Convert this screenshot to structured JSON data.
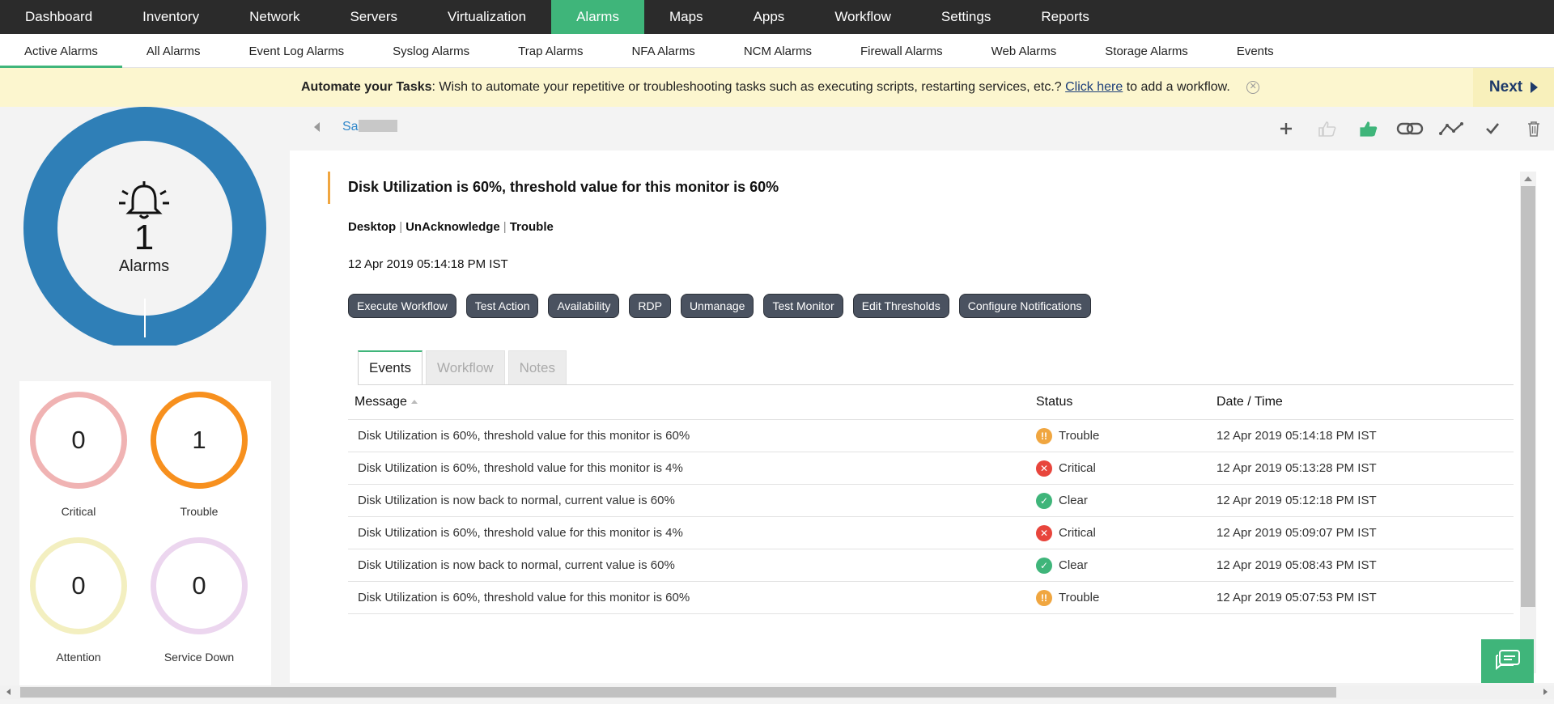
{
  "topnav": {
    "items": [
      "Dashboard",
      "Inventory",
      "Network",
      "Servers",
      "Virtualization",
      "Alarms",
      "Maps",
      "Apps",
      "Workflow",
      "Settings",
      "Reports"
    ],
    "active": "Alarms"
  },
  "subnav": {
    "items": [
      "Active Alarms",
      "All Alarms",
      "Event Log Alarms",
      "Syslog Alarms",
      "Trap Alarms",
      "NFA Alarms",
      "NCM Alarms",
      "Firewall Alarms",
      "Web Alarms",
      "Storage Alarms",
      "Events"
    ],
    "active": "Active Alarms"
  },
  "banner": {
    "bold": "Automate your Tasks",
    "text": ": Wish to automate your repetitive or troubleshooting tasks such as executing scripts, restarting services, etc.?",
    "link": "Click here",
    "after": " to add a workflow.",
    "next": "Next"
  },
  "summary": {
    "count": "1",
    "label": "Alarms",
    "ring_color": "#2f7fb7",
    "severities": [
      {
        "count": "0",
        "label": "Critical",
        "color": "#f0b3b3"
      },
      {
        "count": "1",
        "label": "Trouble",
        "color": "#f7901e"
      },
      {
        "count": "0",
        "label": "Attention",
        "color": "#f3efc0"
      },
      {
        "count": "0",
        "label": "Service Down",
        "color": "#ecd6ef"
      }
    ]
  },
  "detail": {
    "device": "Sa",
    "title": "Disk Utilization is 60%, threshold value for this monitor is 60%",
    "category": "Desktop",
    "ack_status": "UnAcknowledge",
    "severity": "Trouble",
    "time": "12 Apr 2019 05:14:18 PM IST",
    "actions": [
      "Execute Workflow",
      "Test Action",
      "Availability",
      "RDP",
      "Unmanage",
      "Test Monitor",
      "Edit Thresholds",
      "Configure Notifications"
    ],
    "toolbar_icons": [
      "plus-icon",
      "thumbs-up-icon",
      "thumbs-up-filled-icon",
      "link-icon",
      "graph-icon",
      "check-icon",
      "trash-icon"
    ]
  },
  "tabs": {
    "items": [
      "Events",
      "Workflow",
      "Notes"
    ],
    "active": "Events"
  },
  "table": {
    "headers": {
      "message": "Message",
      "status": "Status",
      "datetime": "Date / Time"
    },
    "rows": [
      {
        "message": "Disk Utilization is 60%, threshold value for this monitor is 60%",
        "status": "Trouble",
        "datetime": "12 Apr 2019 05:14:18 PM IST"
      },
      {
        "message": "Disk Utilization is 60%, threshold value for this monitor is 4%",
        "status": "Critical",
        "datetime": "12 Apr 2019 05:13:28 PM IST"
      },
      {
        "message": "Disk Utilization is now back to normal, current value is 60%",
        "status": "Clear",
        "datetime": "12 Apr 2019 05:12:18 PM IST"
      },
      {
        "message": "Disk Utilization is 60%, threshold value for this monitor is 4%",
        "status": "Critical",
        "datetime": "12 Apr 2019 05:09:07 PM IST"
      },
      {
        "message": "Disk Utilization is now back to normal, current value is 60%",
        "status": "Clear",
        "datetime": "12 Apr 2019 05:08:43 PM IST"
      },
      {
        "message": "Disk Utilization is 60%, threshold value for this monitor is 60%",
        "status": "Trouble",
        "datetime": "12 Apr 2019 05:07:53 PM IST"
      }
    ]
  },
  "status_colors": {
    "Trouble": "#f0a640",
    "Critical": "#e8453c",
    "Clear": "#3fb57a"
  }
}
